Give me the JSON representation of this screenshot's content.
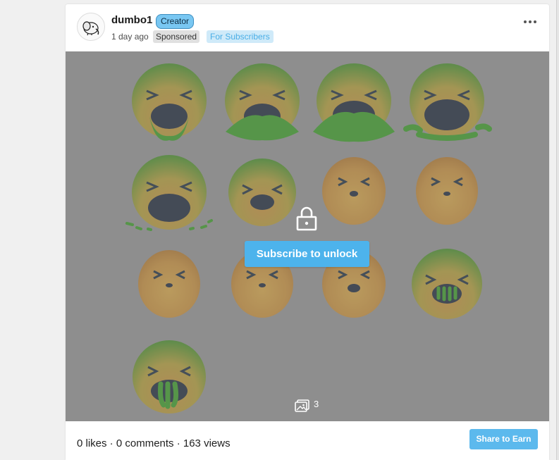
{
  "post": {
    "author": {
      "username": "dumbo1",
      "badge": "Creator",
      "avatar_icon": "elephant-logo-icon"
    },
    "meta": {
      "time_ago": "1 day ago",
      "sponsored_label": "Sponsored",
      "audience_label": "For Subscribers"
    },
    "more_icon": "more-horizontal-icon",
    "media": {
      "lock_icon": "lock-icon",
      "unlock_label": "Subscribe to unlock",
      "gallery_icon": "image-gallery-icon",
      "image_count": "3"
    },
    "footer": {
      "stats": "0 likes · 0 comments · 163 views",
      "share_label": "Share to Earn"
    }
  },
  "colors": {
    "accent": "#4db3ec",
    "creator_badge": "#79c7f2",
    "overlay": "#8e8e8e"
  }
}
